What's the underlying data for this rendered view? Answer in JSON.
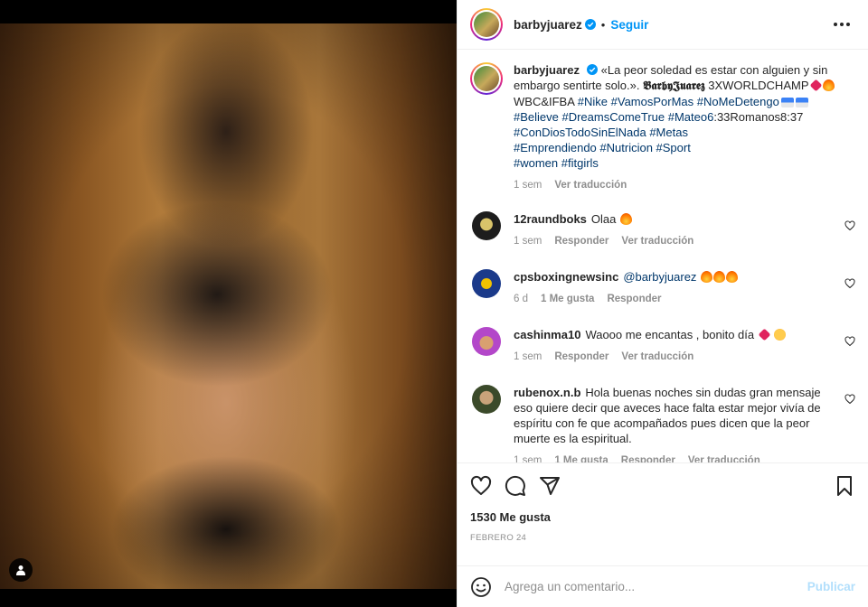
{
  "header": {
    "username": "barbyjuarez",
    "separator": "•",
    "follow_label": "Seguir"
  },
  "caption": {
    "username": "barbyjuarez",
    "text_1": "«La peor soledad es estar con alguien y sin embargo sentirte solo.». ",
    "stylized_name": "𝕭𝖆𝖗𝖇𝖞𝕵𝖚𝖆𝖗𝖊𝖟",
    "text_2": " 3XWORLDCHAMP",
    "text_3": "WBC&IFBA ",
    "hashtags_1": "#Nike #VamosPorMas #NoMeDetengo",
    "hashtags_2": "#Believe #DreamsComeTrue #Mateo6",
    "text_4": ":33Romanos8:37",
    "hashtags_3": "#ConDiosTodoSinElNada #Metas",
    "hashtags_4": "#Emprendiendo #Nutricion #Sport",
    "hashtags_5": "#women #fitgirls",
    "time": "1 sem",
    "see_translation": "Ver traducción"
  },
  "comments": [
    {
      "username": "12raundboks",
      "text": "Olaa",
      "time": "1 sem",
      "reply": "Responder",
      "translate": "Ver traducción",
      "avatar_color": "#1d1d1d"
    },
    {
      "username": "cpsboxingnewsinc",
      "mention": "@barbyjuarez",
      "time": "6 d",
      "likes": "1 Me gusta",
      "reply": "Responder",
      "avatar_color": "#1b3a8a"
    },
    {
      "username": "cashinma10",
      "text": "Waooo me encantas , bonito día",
      "time": "1 sem",
      "reply": "Responder",
      "translate": "Ver traducción",
      "avatar_color": "#b347c9"
    },
    {
      "username": "rubenox.n.b",
      "text": "Hola buenas noches sin dudas gran mensaje eso quiere decir que aveces hace falta estar mejor vivía de espíritu con fe que acompañados pues dicen que la peor muerte es la espiritual.",
      "time": "1 sem",
      "likes": "1 Me gusta",
      "reply": "Responder",
      "translate": "Ver traducción",
      "avatar_color": "#3b4a2a"
    }
  ],
  "actions": {
    "likes": "1530 Me gusta",
    "date": "FEBRERO 24"
  },
  "comment_box": {
    "placeholder": "Agrega un comentario...",
    "post_label": "Publicar"
  },
  "colors": {
    "accent_blue": "#0095f6",
    "hashtag": "#00376b",
    "muted": "#8e8e8e",
    "border": "#efefef"
  }
}
